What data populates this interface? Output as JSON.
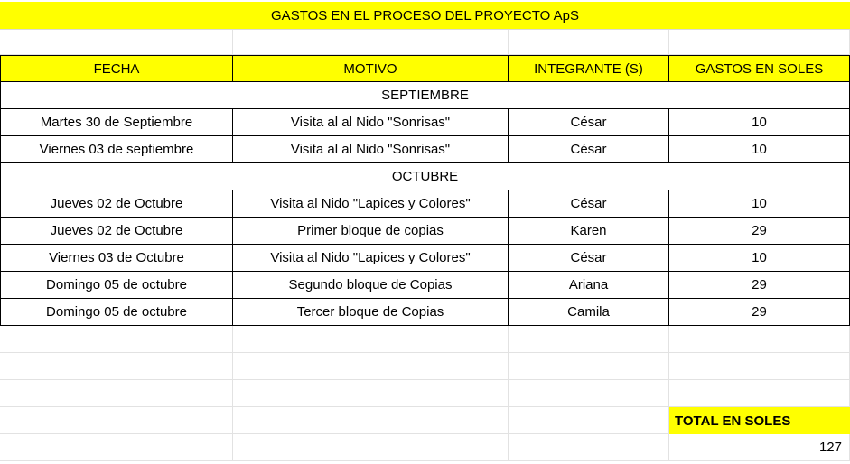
{
  "sheet": {
    "title": "GASTOS EN EL PROCESO DEL PROYECTO ApS",
    "headers": [
      "FECHA",
      "MOTIVO",
      "INTEGRANTE (S)",
      "GASTOS EN SOLES"
    ],
    "months": [
      "SEPTIEMBRE",
      "OCTUBRE"
    ],
    "rows": [
      {
        "fecha": "Martes 30 de Septiembre",
        "motivo": "Visita al al Nido \"Sonrisas\"",
        "integrante": "César",
        "gasto": "10"
      },
      {
        "fecha": "Viernes 03 de septiembre",
        "motivo": "Visita al al Nido \"Sonrisas\"",
        "integrante": "César",
        "gasto": "10"
      },
      {
        "fecha": "Jueves 02 de Octubre",
        "motivo": "Visita al Nido \"Lapices y Colores\"",
        "integrante": "César",
        "gasto": "10"
      },
      {
        "fecha": "Jueves 02 de Octubre",
        "motivo": "Primer bloque de copias",
        "integrante": "Karen",
        "gasto": "29"
      },
      {
        "fecha": "Viernes  03 de Octubre",
        "motivo": "Visita al Nido \"Lapices y Colores\"",
        "integrante": "César",
        "gasto": "10"
      },
      {
        "fecha": "Domingo 05 de octubre",
        "motivo": "Segundo bloque de Copias",
        "integrante": "Ariana",
        "gasto": "29"
      },
      {
        "fecha": "Domingo 05 de octubre",
        "motivo": "Tercer bloque de Copias",
        "integrante": "Camila",
        "gasto": "29"
      }
    ],
    "total_label": "TOTAL EN SOLES",
    "total_value": "127"
  }
}
